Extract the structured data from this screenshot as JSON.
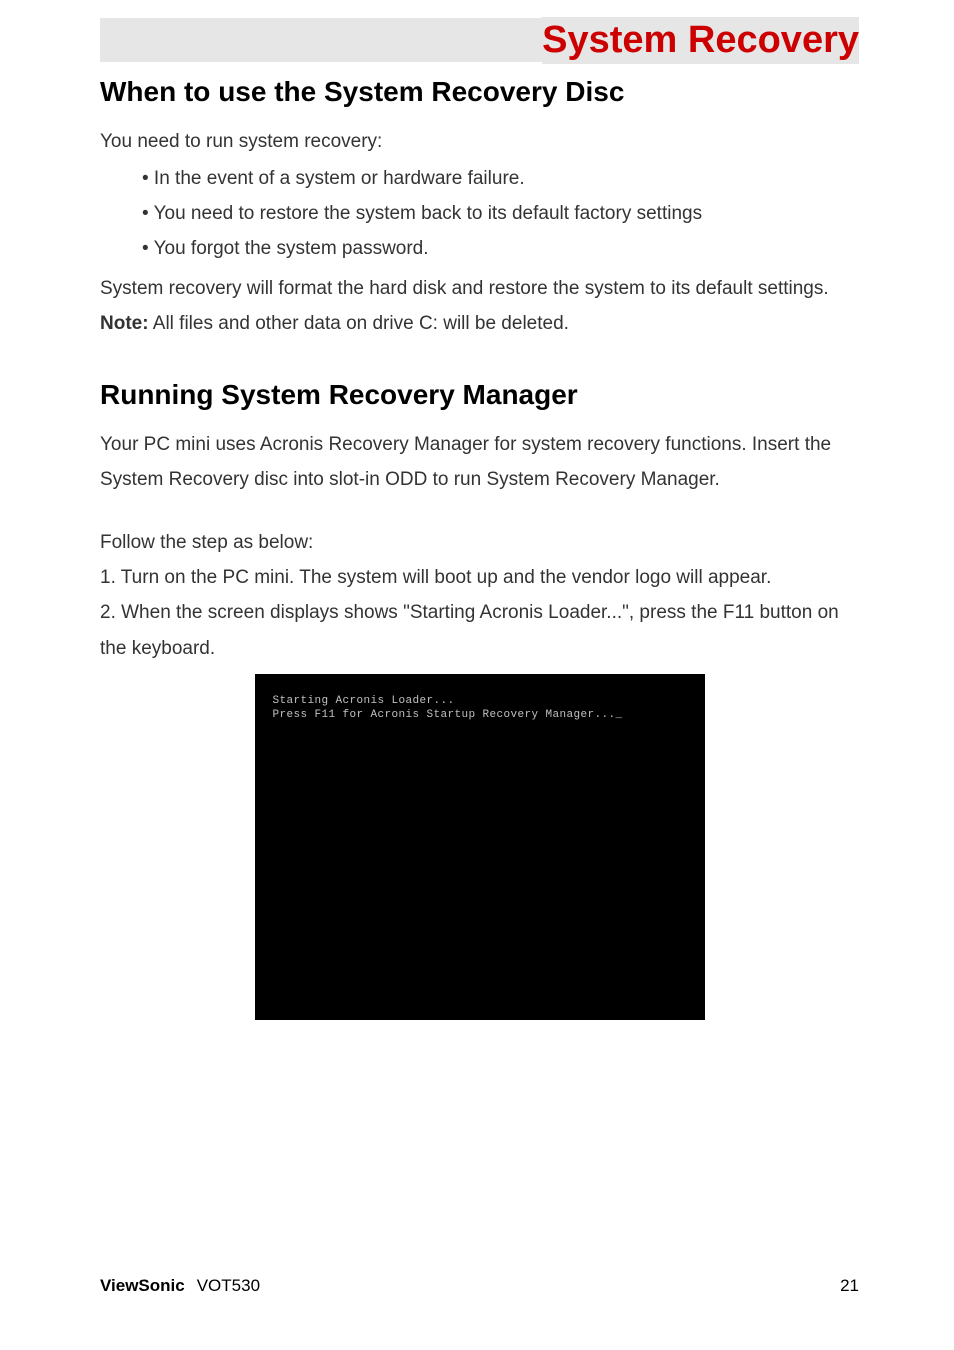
{
  "header": {
    "title": "System Recovery"
  },
  "section1": {
    "heading": "When to use the System Recovery Disc",
    "intro": "You need to run system recovery:",
    "bullets": [
      "• In the event of a system or hardware failure.",
      "• You need to restore the system back to its default factory settings",
      "• You forgot the system password."
    ],
    "after1": "System recovery will format the hard disk and restore the system to its default settings.",
    "note_label": "Note:",
    "note_text": " All files and other data on drive C: will be deleted."
  },
  "section2": {
    "heading": "Running System Recovery Manager",
    "para1": "Your PC mini uses Acronis Recovery Manager for system recovery functions. Insert the System Recovery disc into slot-in ODD to run System Recovery Manager.",
    "follow": "Follow the step as below:",
    "step1": "1. Turn on the PC mini. The system will boot up and the vendor logo will appear.",
    "step2": "2. When the screen displays shows \"Starting Acronis Loader...\", press the F11 button on the keyboard."
  },
  "screenshot": {
    "line1": "Starting Acronis Loader...",
    "line2": "Press F11 for Acronis Startup Recovery Manager..._"
  },
  "footer": {
    "brand": "ViewSonic",
    "model": "VOT530",
    "page": "21"
  }
}
